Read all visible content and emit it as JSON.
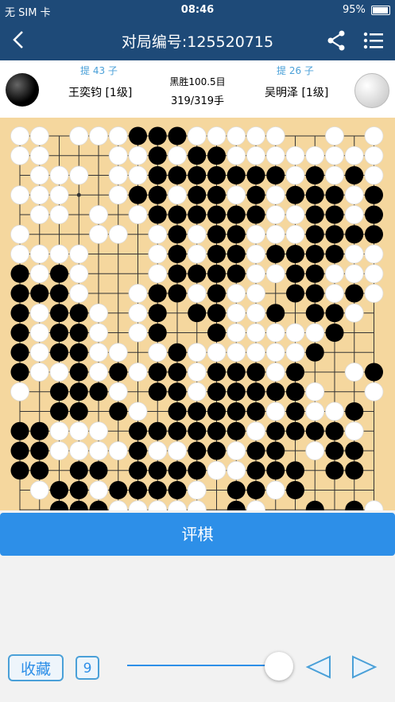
{
  "status_bar": {
    "carrier": "无 SIM 卡",
    "time": "08:46",
    "battery": "95%",
    "battery_level": 0.95
  },
  "nav": {
    "title": "对局编号:125520715",
    "icons": [
      "back-icon",
      "share-icon",
      "menu-list-icon"
    ]
  },
  "players": {
    "black": {
      "name": "王奕钧 [1级]",
      "captures": "提 43 子"
    },
    "white": {
      "name": "吴明泽 [1级]",
      "captures": "提 26 子"
    },
    "result": "黑胜100.5目",
    "moves": "319/319手"
  },
  "board": {
    "size": 19,
    "rows": [
      "WW.WWWBBBWWWWW..W.W",
      "WW...WWBWBBWWWWWWWW",
      ".WWW.WWBBBBBBBWBWBW",
      "WWW..WBBWBBWBWBBBWB",
      ".WW.W.WBBBBBBWWBBWB",
      "W...WW.WBWBBWWWBBBB",
      "WWWW...WBWBBWBBBBWW",
      "BWBW...WBBBBWWBBWWW",
      "BBBW..WBBWBWW.BBWBW",
      "BWBBW.WB.BBWWB.BBW.",
      "BWBBW.WB..BWWWWWB..",
      "BWBBWW.WBWWWWWWB...",
      "BWWBWBWBBWBBBWB..WB",
      "W.BBBW.BBWBBBBBW..W",
      "..BB.BW.BBBBBWBWWB.",
      "BBWWW.BBBBBBWBBBBW.",
      "BBWWWWBWWBBWBB.WBB.",
      "BB.BB.BBBBWWBBB.BB.",
      ".WBBWBBBBW.BBWB....",
      "..BBBWWWWW.BW..B.BW",
      "..B.BBWBBWWBBBB.BB."
    ]
  },
  "review_label": "评棋",
  "controls": {
    "fav_label": "收藏",
    "number_label": "9",
    "progress": 1.0
  },
  "colors": {
    "nav": "#1e4a78",
    "board": "#f5d79e",
    "accent": "#2d8fe8"
  }
}
